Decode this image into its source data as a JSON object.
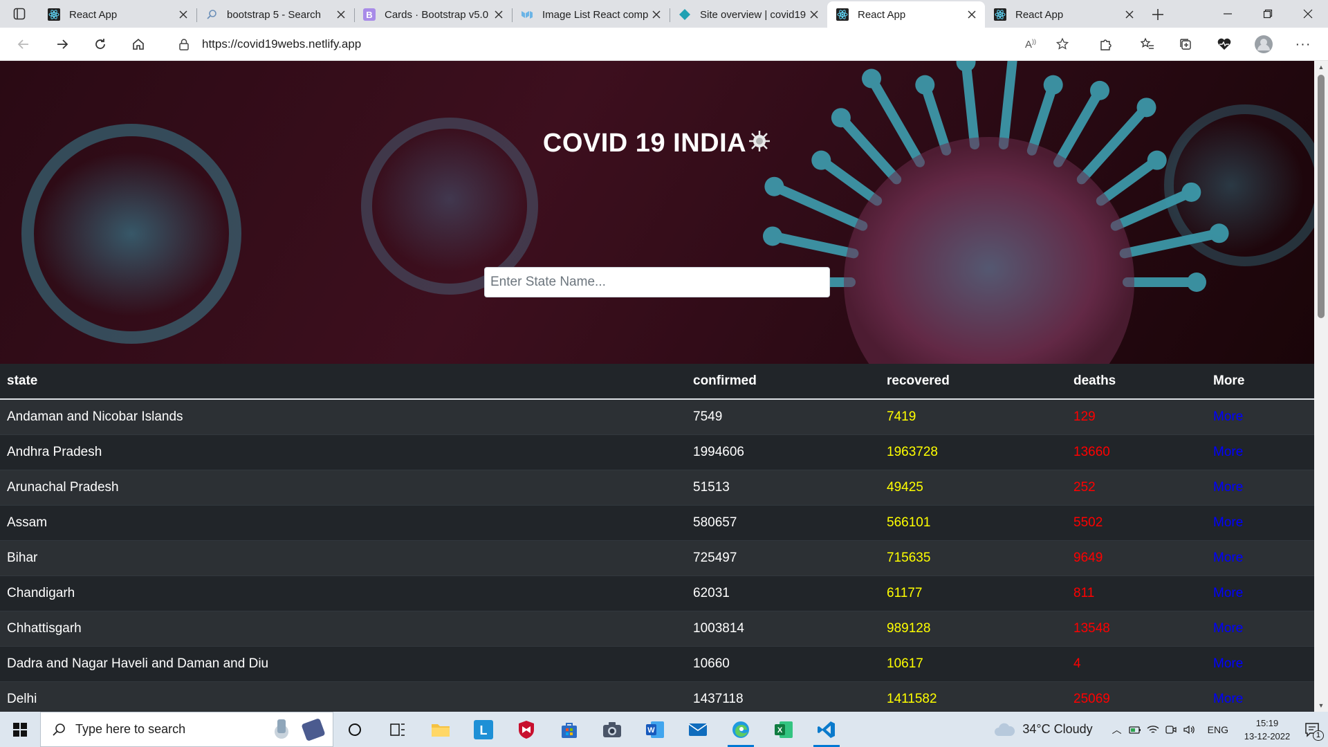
{
  "browser": {
    "tabs": [
      {
        "title": "React App",
        "favicon": "react-icon",
        "active": false
      },
      {
        "title": "bootstrap 5 - Search",
        "favicon": "search-icon",
        "active": false
      },
      {
        "title": "Cards · Bootstrap v5.0",
        "favicon": "bootstrap-icon",
        "active": false
      },
      {
        "title": "Image List React comp",
        "favicon": "mui-icon",
        "active": false
      },
      {
        "title": "Site overview | covid19",
        "favicon": "netlify-icon",
        "active": false
      },
      {
        "title": "React App",
        "favicon": "react-icon",
        "active": true
      },
      {
        "title": "React App",
        "favicon": "react-icon",
        "active": false
      }
    ],
    "url": "https://covid19webs.netlify.app"
  },
  "hero": {
    "title": "COVID 19 INDIA",
    "title_emoji": "virus-icon",
    "search_placeholder": "Enter State Name..."
  },
  "table": {
    "headers": {
      "state": "state",
      "confirmed": "confirmed",
      "recovered": "recovered",
      "deaths": "deaths",
      "more": "More"
    },
    "colors": {
      "recovered": "#ffff00",
      "deaths": "#ff0000",
      "more": "#0000ff"
    },
    "rows": [
      {
        "state": "Andaman and Nicobar Islands",
        "confirmed": "7549",
        "recovered": "7419",
        "deaths": "129",
        "more": "More"
      },
      {
        "state": "Andhra Pradesh",
        "confirmed": "1994606",
        "recovered": "1963728",
        "deaths": "13660",
        "more": "More"
      },
      {
        "state": "Arunachal Pradesh",
        "confirmed": "51513",
        "recovered": "49425",
        "deaths": "252",
        "more": "More"
      },
      {
        "state": "Assam",
        "confirmed": "580657",
        "recovered": "566101",
        "deaths": "5502",
        "more": "More"
      },
      {
        "state": "Bihar",
        "confirmed": "725497",
        "recovered": "715635",
        "deaths": "9649",
        "more": "More"
      },
      {
        "state": "Chandigarh",
        "confirmed": "62031",
        "recovered": "61177",
        "deaths": "811",
        "more": "More"
      },
      {
        "state": "Chhattisgarh",
        "confirmed": "1003814",
        "recovered": "989128",
        "deaths": "13548",
        "more": "More"
      },
      {
        "state": "Dadra and Nagar Haveli and Daman and Diu",
        "confirmed": "10660",
        "recovered": "10617",
        "deaths": "4",
        "more": "More"
      },
      {
        "state": "Delhi",
        "confirmed": "1437118",
        "recovered": "1411582",
        "deaths": "25069",
        "more": "More"
      }
    ]
  },
  "taskbar": {
    "search_placeholder": "Type here to search",
    "weather": "34°C  Cloudy",
    "language": "ENG",
    "time": "15:19",
    "date": "13-12-2022",
    "notification_count": "1"
  }
}
